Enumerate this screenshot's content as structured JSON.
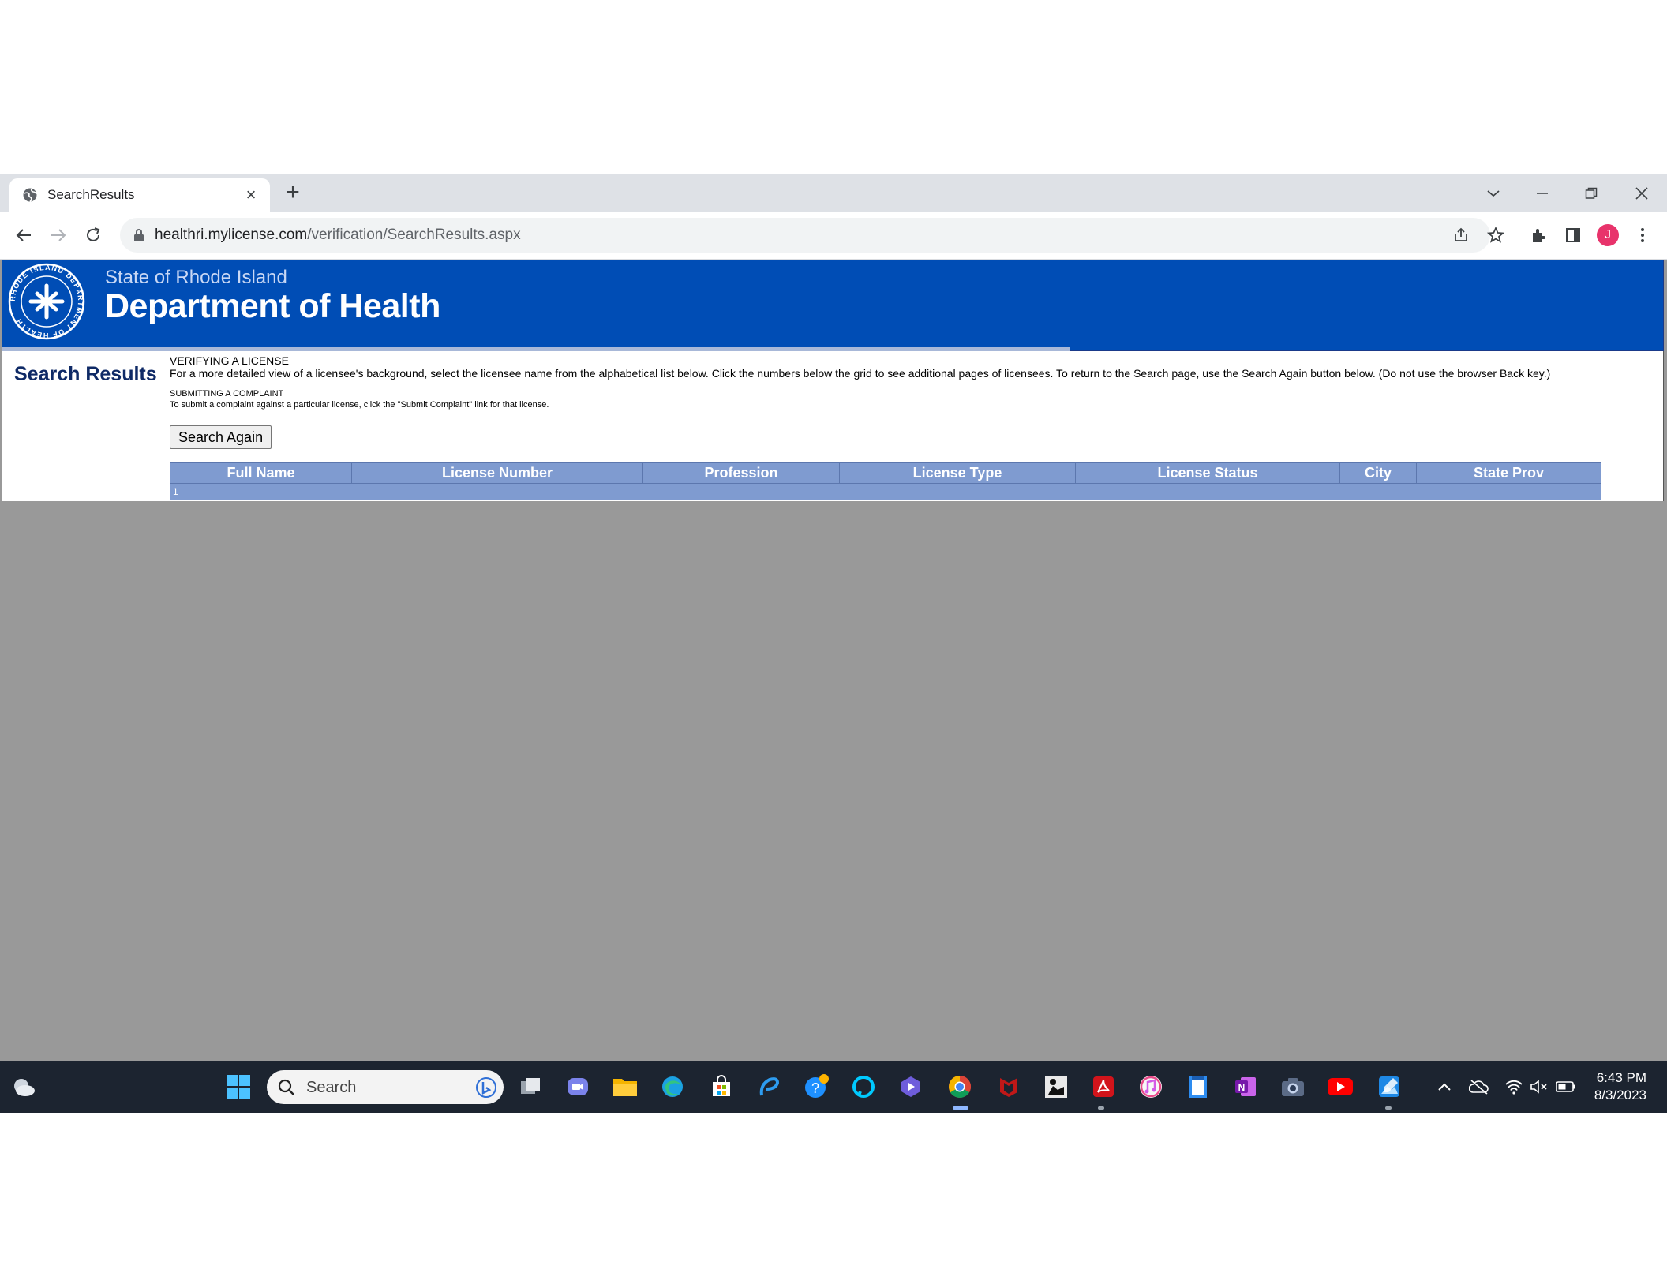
{
  "browser": {
    "tab_title": "SearchResults",
    "url_host": "healthri.mylicense.com",
    "url_path": "/verification/SearchResults.aspx",
    "profile_initial": "J"
  },
  "banner": {
    "state": "State of Rhode Island",
    "department": "Department of Health",
    "seal_text": "RHODE ISLAND DEPARTMENT OF HEALTH"
  },
  "page": {
    "title": "Search Results",
    "verify_heading": "VERIFYING A LICENSE",
    "verify_text": "For a more detailed view of a licensee's background, select the licensee name from the alphabetical list below. Click the numbers below the grid to see additional pages of licensees. To return to the Search page, use the Search Again button below. (Do not use the browser Back key.)",
    "complaint_heading": "SUBMITTING A COMPLAINT",
    "complaint_text": "To submit a complaint against a particular license, click the \"Submit Complaint\" link for that license.",
    "search_again_label": "Search Again",
    "columns": [
      "Full Name",
      "License Number",
      "Profession",
      "License Type",
      "License Status",
      "City",
      "State Prov"
    ],
    "pager": "1"
  },
  "taskbar": {
    "search_placeholder": "Search",
    "time": "6:43 PM",
    "date": "8/3/2023"
  },
  "colors": {
    "banner_blue": "#004db5",
    "grid_header": "#7f9bd0",
    "page_gray": "#999999",
    "taskbar": "#1c2430"
  }
}
